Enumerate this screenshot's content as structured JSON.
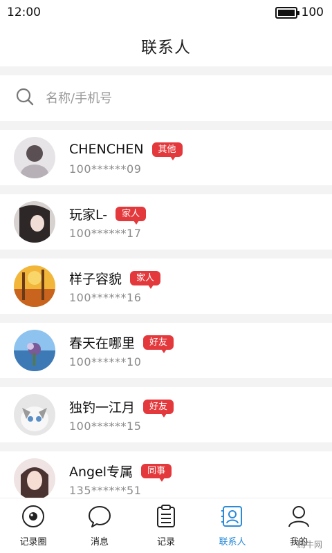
{
  "status_bar": {
    "time": "12:00",
    "battery_level": "100"
  },
  "header": {
    "title": "联系人"
  },
  "search": {
    "placeholder": "名称/手机号",
    "value": ""
  },
  "contacts": [
    {
      "name": "CHENCHEN",
      "tag": "其他",
      "phone": "100******09",
      "avatar_color": "#c8c3c8"
    },
    {
      "name": "玩家L-",
      "tag": "家人",
      "phone": "100******17",
      "avatar_color": "#4a4344"
    },
    {
      "name": "样子容貌",
      "tag": "家人",
      "phone": "100******16",
      "avatar_color": "#e09a2a"
    },
    {
      "name": "春天在哪里",
      "tag": "好友",
      "phone": "100******10",
      "avatar_color": "#4f97d3"
    },
    {
      "name": "独钓一江月",
      "tag": "好友",
      "phone": "100******15",
      "avatar_color": "#d9d9d9"
    },
    {
      "name": "Angel专属",
      "tag": "同事",
      "phone": "135******51",
      "avatar_color": "#e9c7c0"
    }
  ],
  "tabs": [
    {
      "label": "记录圈",
      "icon": "eye-circle-icon",
      "active": false
    },
    {
      "label": "消息",
      "icon": "chat-bubble-icon",
      "active": false
    },
    {
      "label": "记录",
      "icon": "clipboard-list-icon",
      "active": false
    },
    {
      "label": "联系人",
      "icon": "contact-card-icon",
      "active": true
    },
    {
      "label": "我的",
      "icon": "person-icon",
      "active": false
    }
  ],
  "watermark": "腾牛网",
  "colors": {
    "tag": "#e4393c",
    "active_tab": "#2b8bd8",
    "background": "#f3f3f3"
  }
}
